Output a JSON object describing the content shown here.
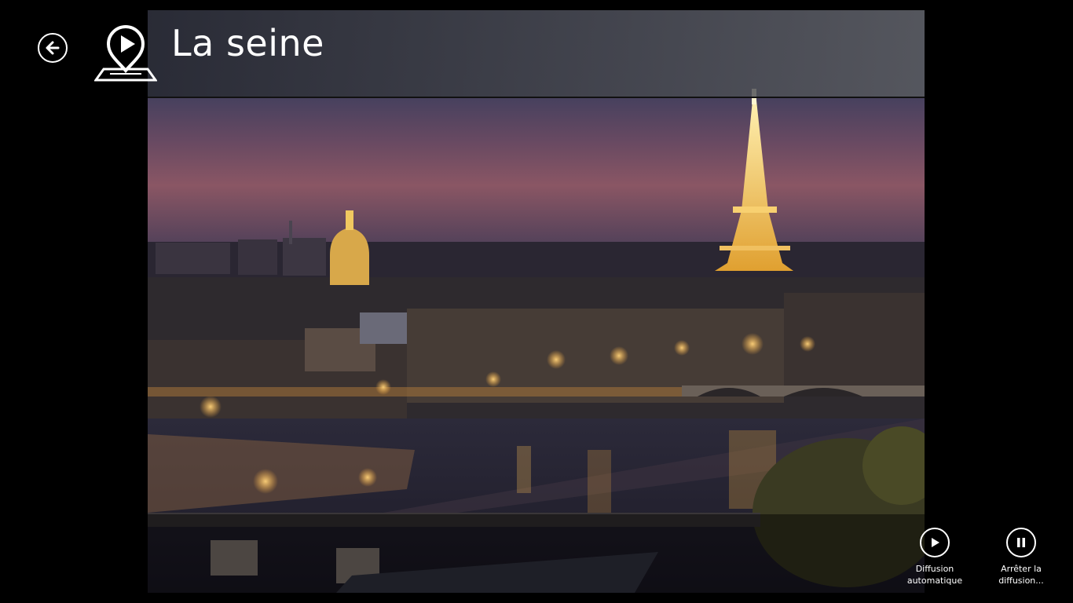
{
  "header": {
    "title": "La seine",
    "back_icon": "arrow-left-icon",
    "logo_icon": "map-pin-play-icon"
  },
  "photo": {
    "subject": "Paris at dusk with the Eiffel Tower, Invalides dome and the Seine"
  },
  "appbar": {
    "play": {
      "label": "Diffusion\nautomatique",
      "icon": "play-icon"
    },
    "stop": {
      "label": "Arrêter la\ndiffusion...",
      "icon": "pause-icon"
    }
  },
  "colors": {
    "background": "#000000",
    "foreground": "#ffffff",
    "header_band": "#3c3e48"
  }
}
